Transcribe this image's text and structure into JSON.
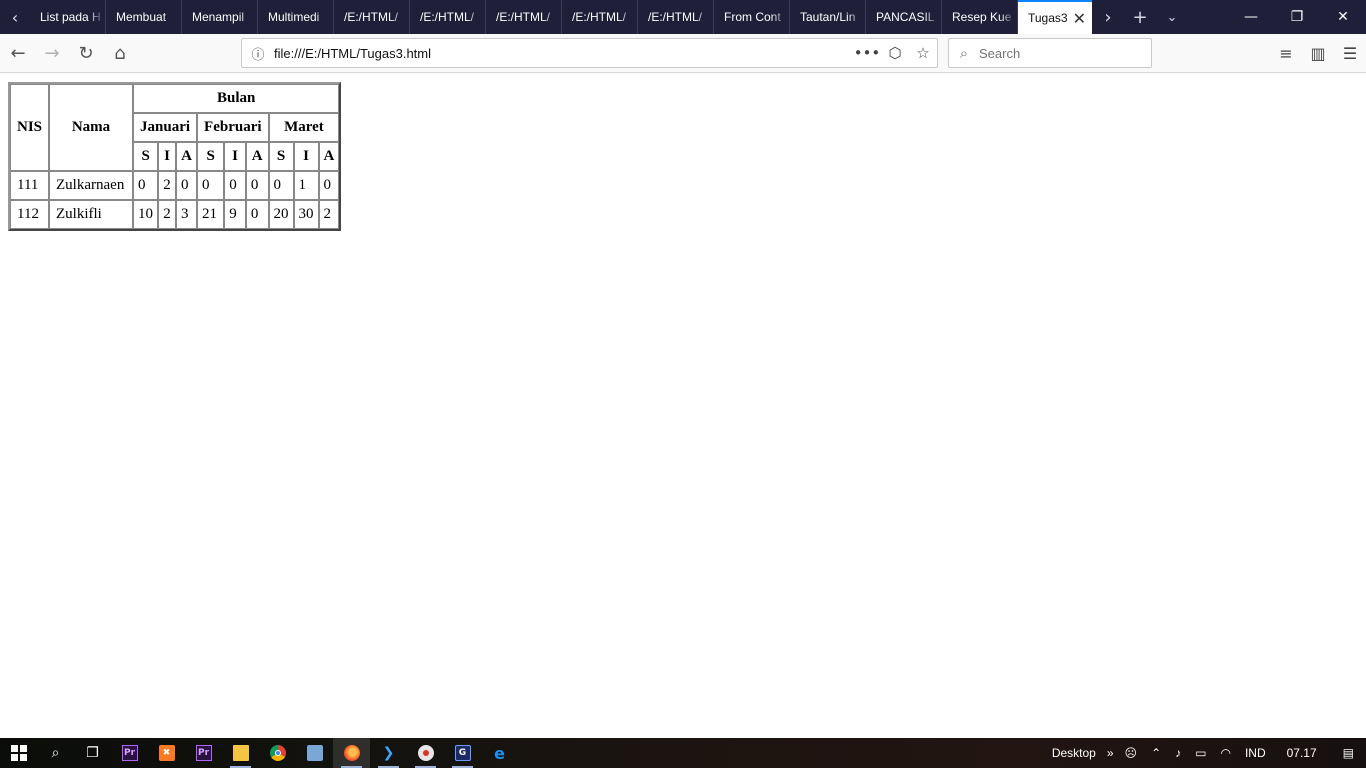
{
  "browser": {
    "tabs": [
      {
        "label": "List pada H"
      },
      {
        "label": "Membuat"
      },
      {
        "label": "Menampil"
      },
      {
        "label": "Multimedi"
      },
      {
        "label": "/E:/HTML/"
      },
      {
        "label": "/E:/HTML/"
      },
      {
        "label": "/E:/HTML/"
      },
      {
        "label": "/E:/HTML/"
      },
      {
        "label": "/E:/HTML/"
      },
      {
        "label": "From Cont"
      },
      {
        "label": "Tautan/Lin"
      },
      {
        "label": "PANCASIL"
      },
      {
        "label": "Resep Kue"
      }
    ],
    "active_tab": {
      "label": "Tugas3"
    },
    "url": "file:///E:/HTML/Tugas3.html",
    "search_placeholder": "Search"
  },
  "table": {
    "headers": {
      "nis": "NIS",
      "nama": "Nama",
      "bulan": "Bulan",
      "months": [
        "Januari",
        "Februari",
        "Maret"
      ],
      "sub": [
        "S",
        "I",
        "A",
        "S",
        "I",
        "A",
        "S",
        "I",
        "A"
      ]
    },
    "rows": [
      {
        "nis": "111",
        "nama": "Zulkarnaen",
        "values": [
          "0",
          "2",
          "0",
          "0",
          "0",
          "0",
          "0",
          "1",
          "0"
        ]
      },
      {
        "nis": "112",
        "nama": "Zulkifli",
        "values": [
          "10",
          "2",
          "3",
          "21",
          "9",
          "0",
          "20",
          "30",
          "2"
        ]
      }
    ]
  },
  "taskbar": {
    "desktop_label": "Desktop",
    "language": "IND",
    "time": "07.17"
  },
  "colors": {
    "tabstrip": "#1f1f3a",
    "accent": "#0a84ff"
  }
}
